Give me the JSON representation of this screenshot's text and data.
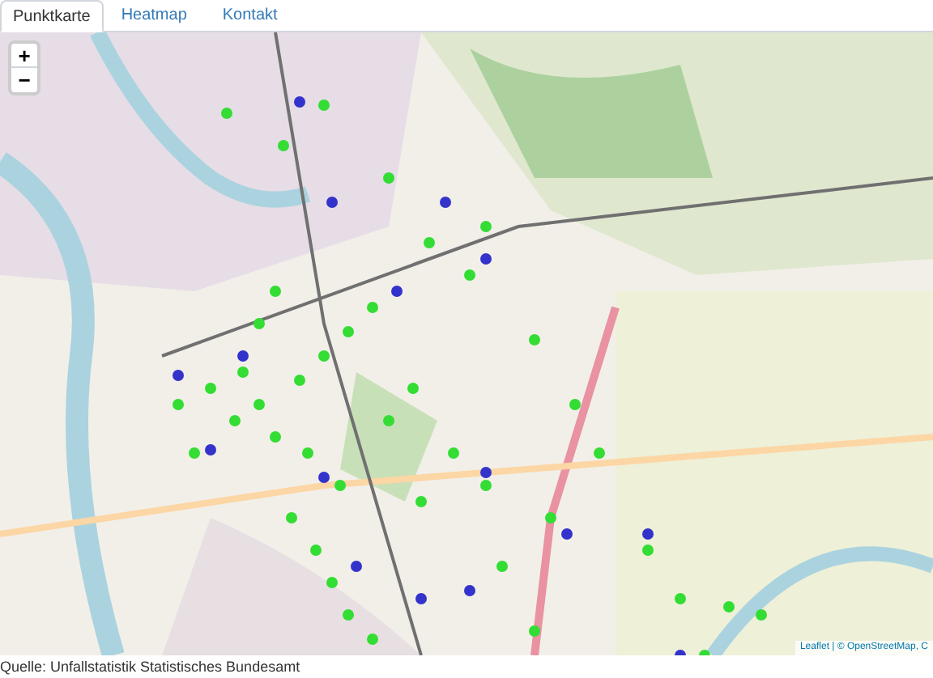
{
  "tabs": [
    {
      "label": "Punktkarte",
      "selected": true
    },
    {
      "label": "Heatmap",
      "selected": false
    },
    {
      "label": "Kontakt",
      "selected": false
    }
  ],
  "map": {
    "kind": "picture",
    "zoom_in": "+",
    "zoom_out": "−",
    "attribution": "Leaflet | © OpenStreetMap, C"
  },
  "source": "Quelle: Unfallstatistik Statistisches Bundesamt"
}
